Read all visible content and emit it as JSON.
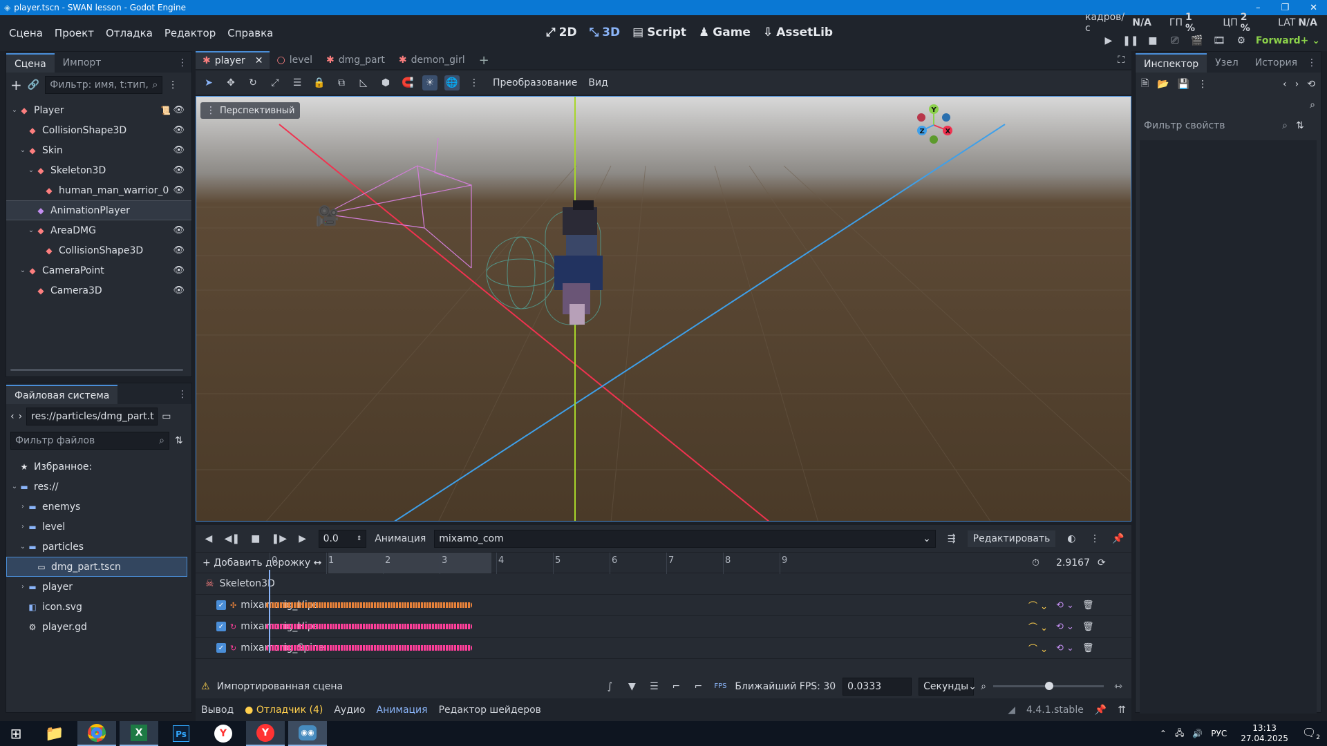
{
  "window": {
    "title": "player.tscn - SWAN lesson - Godot Engine"
  },
  "menu": {
    "items": [
      "Сцена",
      "Проект",
      "Отладка",
      "Редактор",
      "Справка"
    ]
  },
  "workspaces": [
    {
      "label": "2D",
      "icon": "2d-icon"
    },
    {
      "label": "3D",
      "icon": "3d-icon"
    },
    {
      "label": "Script",
      "icon": "script-icon"
    },
    {
      "label": "Game",
      "icon": "game-icon"
    },
    {
      "label": "AssetLib",
      "icon": "assetlib-icon"
    }
  ],
  "stats": {
    "fps_label": "кадров/с",
    "fps_value": "N/A",
    "gpu_label": "ГП",
    "gpu_value": "1 %",
    "cpu_label": "ЦП",
    "cpu_value": "2 %",
    "lat_label": "LAT",
    "lat_value": "N/A"
  },
  "renderer": "Forward+",
  "scene_dock": {
    "tabs": [
      "Сцена",
      "Импорт"
    ],
    "filter_placeholder": "Фильтр: имя, t:тип,",
    "nodes": [
      {
        "name": "Player",
        "depth": 0,
        "arrow": "v",
        "icon_color": "#fc7f7f",
        "eye": true,
        "script": true
      },
      {
        "name": "CollisionShape3D",
        "depth": 1,
        "arrow": "",
        "icon_color": "#fc7f7f",
        "eye": true
      },
      {
        "name": "Skin",
        "depth": 1,
        "arrow": "v",
        "icon_color": "#fc7f7f",
        "eye": true
      },
      {
        "name": "Skeleton3D",
        "depth": 2,
        "arrow": "v",
        "icon_color": "#fc7f7f",
        "eye": true
      },
      {
        "name": "human_man_warrior_0",
        "depth": 3,
        "arrow": "",
        "icon_color": "#fc7f7f",
        "eye": true
      },
      {
        "name": "AnimationPlayer",
        "depth": 2,
        "arrow": "",
        "icon_color": "#c38ef1",
        "eye": false,
        "selected": true
      },
      {
        "name": "AreaDMG",
        "depth": 2,
        "arrow": "v",
        "icon_color": "#fc7f7f",
        "eye": true
      },
      {
        "name": "CollisionShape3D",
        "depth": 3,
        "arrow": "",
        "icon_color": "#fc7f7f",
        "eye": true
      },
      {
        "name": "CameraPoint",
        "depth": 1,
        "arrow": "v",
        "icon_color": "#fc7f7f",
        "eye": true
      },
      {
        "name": "Camera3D",
        "depth": 2,
        "arrow": "",
        "icon_color": "#fc7f7f",
        "eye": true
      }
    ]
  },
  "filesystem": {
    "title": "Файловая система",
    "path": "res://particles/dmg_part.t",
    "filter_placeholder": "Фильтр файлов",
    "items": [
      {
        "name": "Избранное:",
        "depth": 0,
        "arrow": "",
        "icon": "star-icon"
      },
      {
        "name": "res://",
        "depth": 0,
        "arrow": "v",
        "icon": "folder-icon"
      },
      {
        "name": "enemys",
        "depth": 1,
        "arrow": ">",
        "icon": "folder-icon"
      },
      {
        "name": "level",
        "depth": 1,
        "arrow": ">",
        "icon": "folder-icon"
      },
      {
        "name": "particles",
        "depth": 1,
        "arrow": "v",
        "icon": "folder-icon"
      },
      {
        "name": "dmg_part.tscn",
        "depth": 2,
        "arrow": "",
        "icon": "scene-file-icon",
        "selected": true
      },
      {
        "name": "player",
        "depth": 1,
        "arrow": ">",
        "icon": "folder-icon"
      },
      {
        "name": "icon.svg",
        "depth": 1,
        "arrow": "",
        "icon": "image-file-icon"
      },
      {
        "name": "player.gd",
        "depth": 1,
        "arrow": "",
        "icon": "gear-icon"
      }
    ]
  },
  "editor_tabs": [
    {
      "label": "player",
      "active": true,
      "close": true
    },
    {
      "label": "level"
    },
    {
      "label": "dmg_part"
    },
    {
      "label": "demon_girl"
    }
  ],
  "viewport_toolbar": {
    "transform": "Преобразование",
    "view": "Вид"
  },
  "viewport": {
    "label": "Перспективный"
  },
  "animation": {
    "time": "0.0",
    "label": "Анимация",
    "current": "mixamo_com",
    "edit": "Редактировать",
    "add_track": "Добавить дорожку",
    "length": "2.9167",
    "ruler": [
      "0",
      "1",
      "2",
      "3",
      "4",
      "5",
      "6",
      "7",
      "8",
      "9"
    ],
    "root": "Skeleton3D",
    "tracks": [
      {
        "name": "mixamorig_Hips",
        "color": "#e8823a",
        "icon": "position-track-icon"
      },
      {
        "name": "mixamorig_Hips",
        "color": "#ff3f9a",
        "icon": "rotation-track-icon"
      },
      {
        "name": "mixamorig_Spine",
        "color": "#ff3f9a",
        "icon": "rotation-track-icon"
      }
    ],
    "imported_warning": "Импортированная сцена",
    "snap_label": "Ближайший FPS: 30",
    "snap_value": "0.0333",
    "units": "Секунды"
  },
  "bottom_tabs": {
    "output": "Вывод",
    "debugger": "Отладчик (4)",
    "audio": "Аудио",
    "animation": "Анимация",
    "shader": "Редактор шейдеров",
    "version": "4.4.1.stable"
  },
  "inspector": {
    "tabs": [
      "Инспектор",
      "Узел",
      "История"
    ],
    "filter_placeholder": "Фильтр свойств"
  },
  "gizmo": {
    "x": "X",
    "y": "Y",
    "z": "Z"
  },
  "taskbar": {
    "lang": "РУС",
    "time": "13:13",
    "date": "27.04.2025",
    "notifications": "2"
  }
}
